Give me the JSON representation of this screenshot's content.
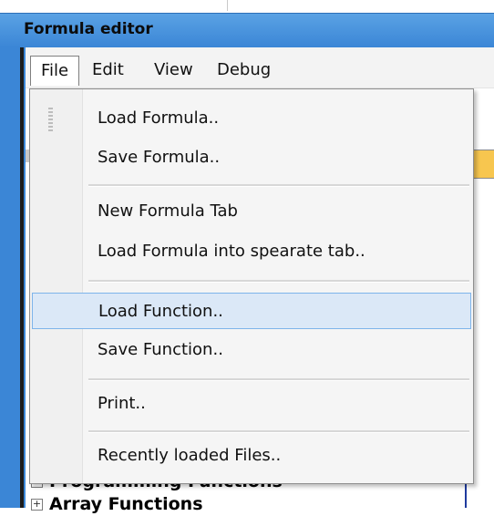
{
  "window": {
    "title": "Formula editor"
  },
  "menubar": {
    "items": [
      {
        "label": "File",
        "open": true
      },
      {
        "label": "Edit"
      },
      {
        "label": "View"
      },
      {
        "label": "Debug"
      }
    ]
  },
  "file_menu": {
    "items": [
      {
        "label": "Load Formula.."
      },
      {
        "label": "Save Formula.."
      },
      {
        "label": "New Formula Tab"
      },
      {
        "label": "Load Formula into spearate tab.."
      },
      {
        "label": "Load Function..",
        "highlighted": true
      },
      {
        "label": "Save Function.."
      },
      {
        "label": "Print.."
      },
      {
        "label": "Recently loaded Files.."
      }
    ]
  },
  "background": {
    "tree_items": [
      {
        "label": "Programming Functions",
        "expander": ""
      },
      {
        "label": "Array Functions",
        "expander": "+"
      }
    ]
  },
  "colors": {
    "titlebar": "#3b86d6",
    "highlight_fill": "#dbe8f7",
    "highlight_border": "#7eb4ea"
  }
}
